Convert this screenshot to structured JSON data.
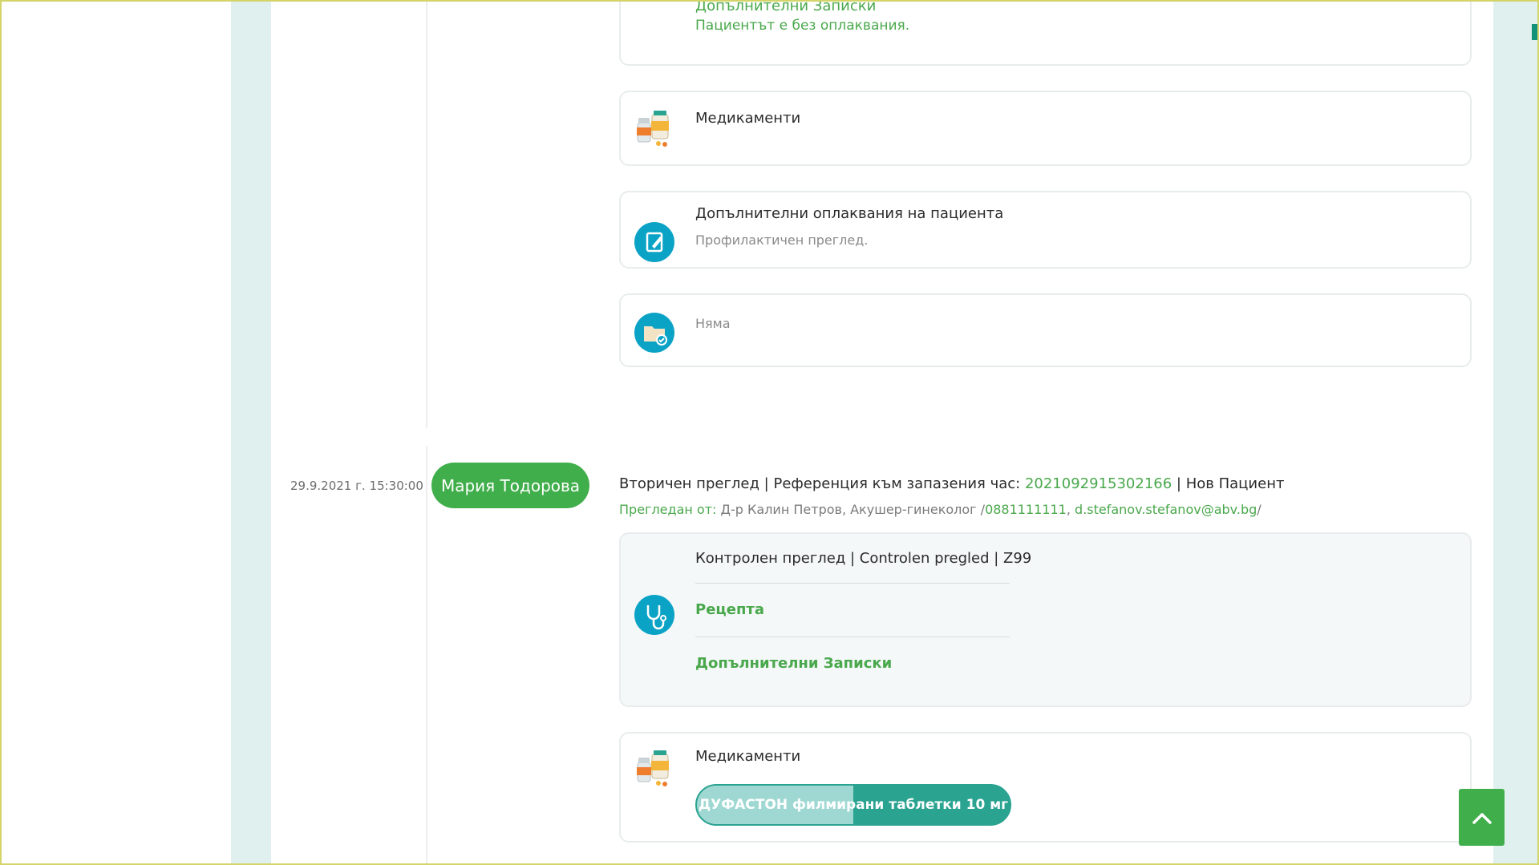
{
  "visit_prev": {
    "notes_title": "Допълнителни Записки",
    "notes_value": "Пациентът е без оплаквания.",
    "meds_title": "Медикаменти",
    "complaints_title": "Допълнителни оплаквания на пациента",
    "complaints_value": "Профилактичен преглед.",
    "files_value": "Няма"
  },
  "visit": {
    "datetime": "29.9.2021 г. 15:30:00",
    "patient_name": "Мария Тодорова",
    "type": "Вторичен преглед",
    "ref_label": "Референция към запазения час:",
    "ref_code": "2021092915302166",
    "status": "Нов Пациент",
    "examined_prefix": "Прегледан от:",
    "doctor": "Д-р Калин Петров, Акушер-гинеколог /",
    "phone": "0881111111",
    "email": "d.stefanov.stefanov@abv.bg",
    "email_suffix": "/",
    "diagnosis": "Контролен преглед | Controlen pregled | Z99",
    "prescription_link": "Рецепта",
    "notes_link": "Допълнителни Записки",
    "meds_title": "Медикаменти",
    "med_name": "ДУФАСТОН филмирани таблетки 10 мг"
  },
  "sep": "|",
  "icons": {
    "meds": "medicine-bottles-icon",
    "complaints": "clipboard-edit-icon",
    "files": "folder-check-icon",
    "diagnosis": "stethoscope-icon",
    "to_top": "chevron-up-icon"
  },
  "colors": {
    "brand_green": "#40ae4a",
    "link_green": "#4aa84c",
    "teal": "#2aa391",
    "icon_blue": "#0aa3c6"
  }
}
